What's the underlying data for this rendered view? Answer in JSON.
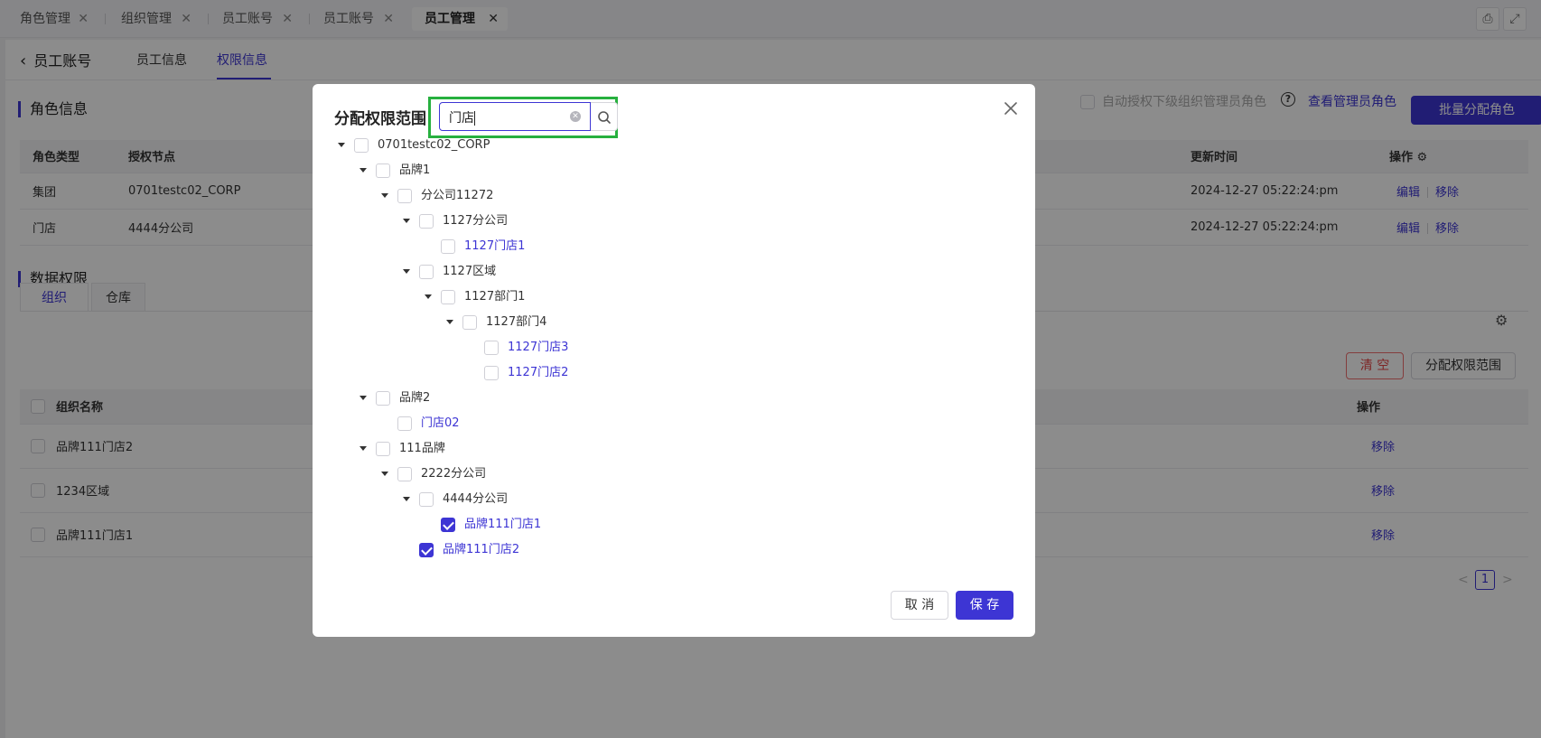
{
  "tabs": [
    {
      "label": "角色管理",
      "active": false
    },
    {
      "label": "组织管理",
      "active": false
    },
    {
      "label": "员工账号",
      "active": false
    },
    {
      "label": "员工账号",
      "active": false
    },
    {
      "label": "员工管理",
      "active": true
    }
  ],
  "subnav": {
    "back_label": "员工账号",
    "tabs": [
      "员工信息",
      "权限信息"
    ]
  },
  "role_section": {
    "title": "角色信息",
    "auto_grant_label": "自动授权下级组织管理员角色",
    "view_admin_link": "查看管理员角色",
    "batch_assign_button": "批量分配角色",
    "columns": {
      "type": "角色类型",
      "node": "授权节点",
      "updated": "更新时间",
      "actions": "操作"
    },
    "rows": [
      {
        "type": "集团",
        "node": "0701testc02_CORP",
        "updated": "2024-12-27 05:22:24:pm",
        "edit": "编辑",
        "remove": "移除"
      },
      {
        "type": "门店",
        "node": "4444分公司",
        "updated": "2024-12-27 05:22:24:pm",
        "edit": "编辑",
        "remove": "移除"
      }
    ]
  },
  "data_section": {
    "title": "数据权限",
    "tabs": [
      "组织",
      "仓库"
    ],
    "clear_button": "清 空",
    "assign_scope_button": "分配权限范围",
    "columns": {
      "name": "组织名称",
      "actions": "操作"
    },
    "rows": [
      {
        "name": "品牌111门店2",
        "remove": "移除"
      },
      {
        "name": "1234区域",
        "remove": "移除"
      },
      {
        "name": "品牌111门店1",
        "remove": "移除"
      }
    ],
    "pager": {
      "prev": "<",
      "current": "1",
      "next": ">"
    }
  },
  "modal": {
    "title": "分配权限范围",
    "search_value": "门店",
    "cancel_label": "取 消",
    "save_label": "保 存",
    "tree": [
      {
        "label": "0701testc02_CORP",
        "level": 0,
        "expanded": true,
        "checked": false,
        "match": false
      },
      {
        "label": "品牌1",
        "level": 1,
        "expanded": true,
        "checked": false,
        "match": false
      },
      {
        "label": "分公司11272",
        "level": 2,
        "expanded": true,
        "checked": false,
        "match": false
      },
      {
        "label": "1127分公司",
        "level": 3,
        "expanded": true,
        "checked": false,
        "match": false
      },
      {
        "label": "1127门店1",
        "level": 4,
        "expanded": false,
        "checked": false,
        "match": true
      },
      {
        "label": "1127区域",
        "level": 3,
        "expanded": true,
        "checked": false,
        "match": false
      },
      {
        "label": "1127部门1",
        "level": 4,
        "expanded": true,
        "checked": false,
        "match": false
      },
      {
        "label": "1127部门4",
        "level": 5,
        "expanded": true,
        "checked": false,
        "match": false
      },
      {
        "label": "1127门店3",
        "level": 6,
        "expanded": false,
        "checked": false,
        "match": true
      },
      {
        "label": "1127门店2",
        "level": 6,
        "expanded": false,
        "checked": false,
        "match": true
      },
      {
        "label": "品牌2",
        "level": 1,
        "expanded": true,
        "checked": false,
        "match": false
      },
      {
        "label": "门店02",
        "level": 2,
        "expanded": false,
        "checked": false,
        "match": true
      },
      {
        "label": "111品牌",
        "level": 1,
        "expanded": true,
        "checked": false,
        "match": false
      },
      {
        "label": "2222分公司",
        "level": 2,
        "expanded": true,
        "checked": false,
        "match": false
      },
      {
        "label": "4444分公司",
        "level": 3,
        "expanded": true,
        "checked": false,
        "match": false
      },
      {
        "label": "品牌111门店1",
        "level": 4,
        "expanded": false,
        "checked": true,
        "match": true
      },
      {
        "label": "品牌111门店2",
        "level": 3,
        "expanded": false,
        "checked": true,
        "match": true
      }
    ]
  },
  "colors": {
    "accent": "#3d35d4",
    "highlight": "#27b03f",
    "danger": "#e54545"
  }
}
